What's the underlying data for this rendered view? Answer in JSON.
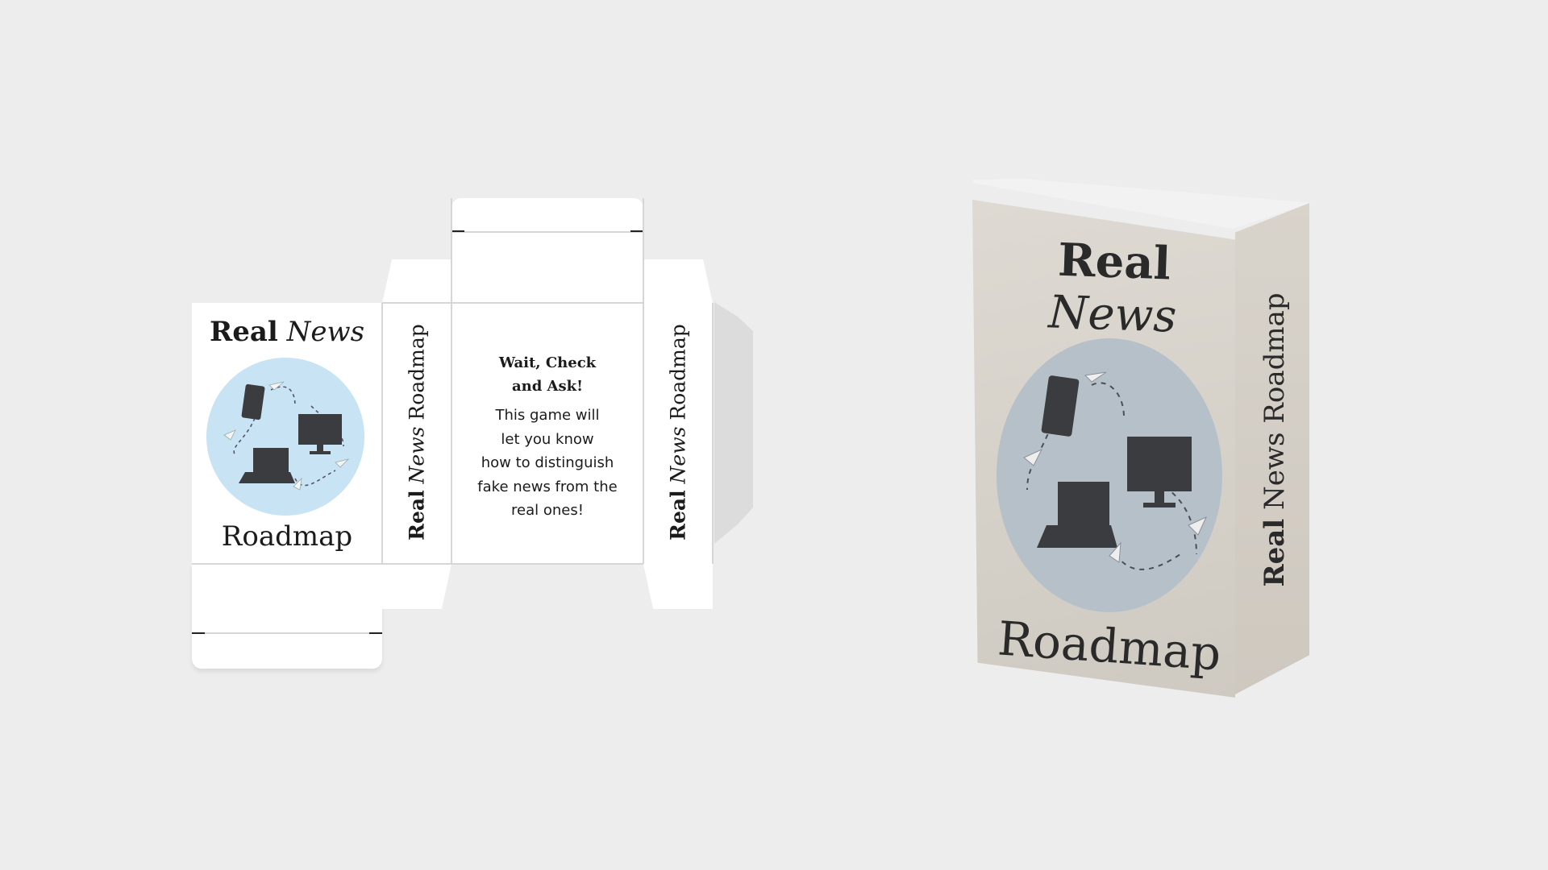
{
  "dieline": {
    "front": {
      "title_bold": "Real",
      "title_italic": "News",
      "subtitle": "Roadmap"
    },
    "spine_left": {
      "bold": "Real",
      "italic": "News",
      "rest": "Roadmap"
    },
    "back": {
      "heading_line1": "Wait, Check",
      "heading_line2": "and Ask!",
      "body_lines": [
        "This game will",
        "let you know",
        "how to distinguish",
        "fake news from the",
        "real ones!"
      ]
    },
    "spine_right": {
      "bold": "Real",
      "italic": "News",
      "rest": "Roadmap"
    }
  },
  "box": {
    "front": {
      "title_bold": "Real",
      "title_italic": "News",
      "subtitle": "Roadmap"
    },
    "side": {
      "bold": "Real",
      "rest": "News Roadmap"
    }
  },
  "colors": {
    "background": "#ededed",
    "circle_flat": "#c7e3f4",
    "circle_box": "#b6c0c8",
    "device": "#3a3c3f"
  },
  "icons": [
    "phone-icon",
    "monitor-icon",
    "laptop-icon",
    "paper-plane-icon"
  ]
}
